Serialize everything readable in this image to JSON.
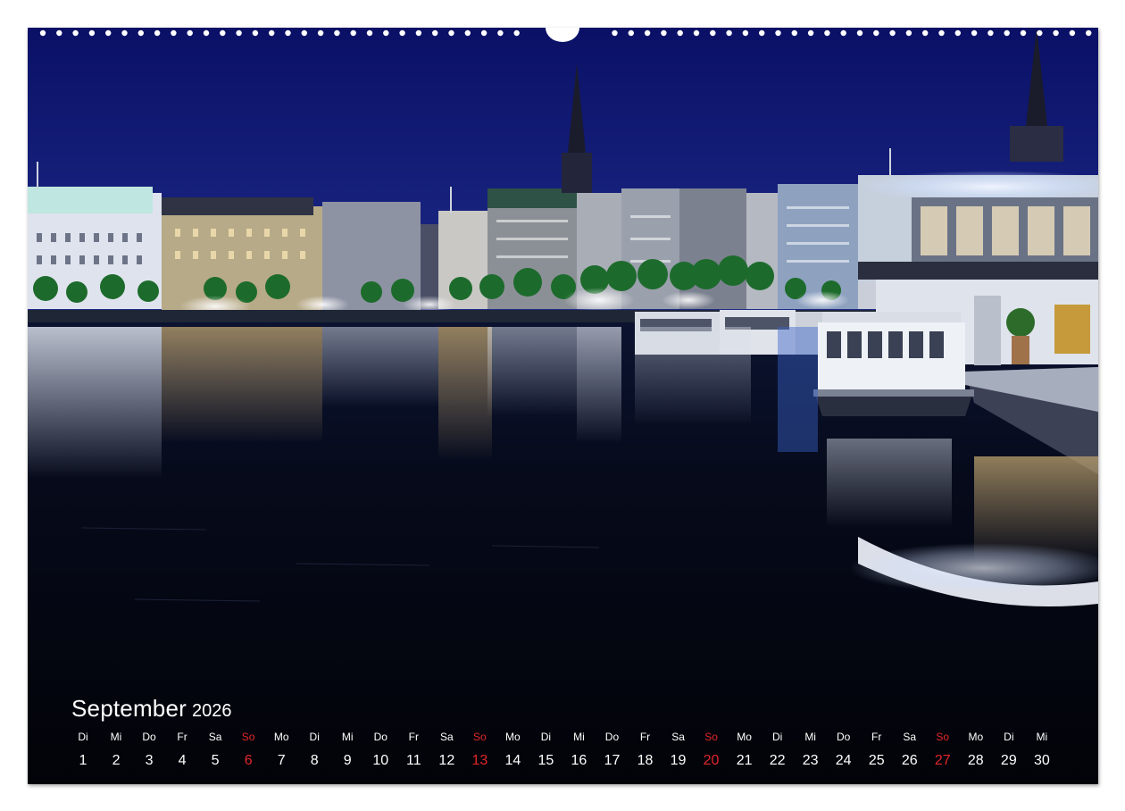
{
  "calendar": {
    "month": "September",
    "year": "2026",
    "days": [
      {
        "dow": "Di",
        "day": "1"
      },
      {
        "dow": "Mi",
        "day": "2"
      },
      {
        "dow": "Do",
        "day": "3"
      },
      {
        "dow": "Fr",
        "day": "4"
      },
      {
        "dow": "Sa",
        "day": "5"
      },
      {
        "dow": "So",
        "day": "6"
      },
      {
        "dow": "Mo",
        "day": "7"
      },
      {
        "dow": "Di",
        "day": "8"
      },
      {
        "dow": "Mi",
        "day": "9"
      },
      {
        "dow": "Do",
        "day": "10"
      },
      {
        "dow": "Fr",
        "day": "11"
      },
      {
        "dow": "Sa",
        "day": "12"
      },
      {
        "dow": "So",
        "day": "13"
      },
      {
        "dow": "Mo",
        "day": "14"
      },
      {
        "dow": "Di",
        "day": "15"
      },
      {
        "dow": "Mi",
        "day": "16"
      },
      {
        "dow": "Do",
        "day": "17"
      },
      {
        "dow": "Fr",
        "day": "18"
      },
      {
        "dow": "Sa",
        "day": "19"
      },
      {
        "dow": "So",
        "day": "20"
      },
      {
        "dow": "Mo",
        "day": "21"
      },
      {
        "dow": "Di",
        "day": "22"
      },
      {
        "dow": "Mi",
        "day": "23"
      },
      {
        "dow": "Do",
        "day": "24"
      },
      {
        "dow": "Fr",
        "day": "25"
      },
      {
        "dow": "Sa",
        "day": "26"
      },
      {
        "dow": "So",
        "day": "27"
      },
      {
        "dow": "Mo",
        "day": "28"
      },
      {
        "dow": "Di",
        "day": "29"
      },
      {
        "dow": "Mi",
        "day": "30"
      }
    ],
    "sunday_label": "So"
  },
  "colors": {
    "sky_top": "#0b1270",
    "sky_bottom": "#1c2a86",
    "water": "#03050c",
    "sunday_red": "#e3262a",
    "text": "#ffffff"
  }
}
